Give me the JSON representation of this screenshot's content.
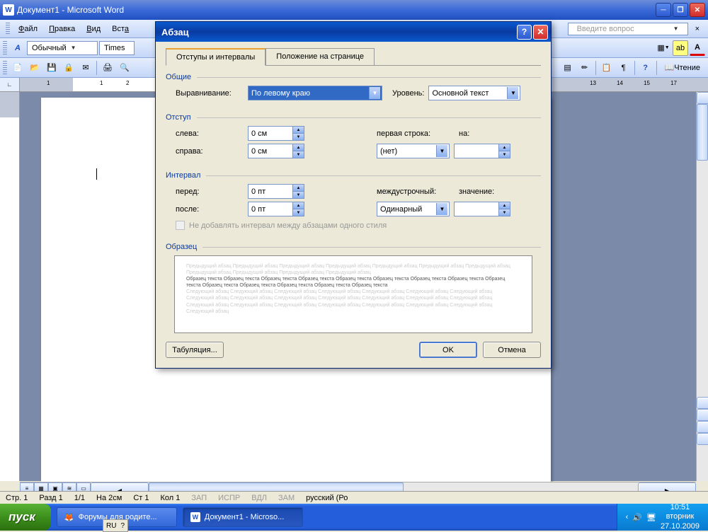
{
  "window": {
    "title": "Документ1 - Microsoft Word"
  },
  "menu": {
    "file": "Файл",
    "edit": "Правка",
    "view": "Вид",
    "insert": "Вста",
    "search_placeholder": "Введите вопрос"
  },
  "toolbar1": {
    "style": "Обычный",
    "font": "Times"
  },
  "toolbar2": {
    "reading": "Чтение"
  },
  "status": {
    "page": "Стр. 1",
    "section": "Разд 1",
    "pages": "1/1",
    "at": "На 2см",
    "line": "Ст 1",
    "col": "Кол 1",
    "rec": "ЗАП",
    "trk": "ИСПР",
    "ext": "ВДЛ",
    "ovr": "ЗАМ",
    "lang": "русский (Ро"
  },
  "taskbar": {
    "start": "пуск",
    "task1": "Форумы для родите...",
    "task2": "Документ1 - Microso...",
    "time": "10:51",
    "day": "вторник",
    "date": "27.10.2009",
    "lang": "RU"
  },
  "dialog": {
    "title": "Абзац",
    "tab1": "Отступы и интервалы",
    "tab2": "Положение на странице",
    "general": "Общие",
    "alignment_label": "Выравнивание:",
    "alignment_value": "По левому краю",
    "level_label": "Уровень:",
    "level_value": "Основной текст",
    "indent": "Отступ",
    "left_label": "слева:",
    "left_value": "0 см",
    "right_label": "справа:",
    "right_value": "0 см",
    "firstline_label": "первая строка:",
    "firstline_value": "(нет)",
    "by_label": "на:",
    "by_value": "",
    "spacing": "Интервал",
    "before_label": "перед:",
    "before_value": "0 пт",
    "after_label": "после:",
    "after_value": "0 пт",
    "linespacing_label": "междустрочный:",
    "linespacing_value": "Одинарный",
    "at_label": "значение:",
    "at_value": "",
    "noextra": "Не добавлять интервал между абзацами одного стиля",
    "preview": "Образец",
    "preview_grey": "Предыдущий абзац Предыдущий абзац Предыдущий абзац Предыдущий абзац Предыдущий абзац Предыдущий абзац Предыдущий абзац Предыдущий абзац Предыдущий абзац Предыдущий абзац Предыдущий абзац",
    "preview_text": "Образец текста Образец текста Образец текста Образец текста Образец текста Образец текста Образец текста Образец текста Образец текста Образец текста Образец текста Образец текста Образец текста Образец текста",
    "preview_grey2": "Следующий абзац Следующий абзац Следующий абзац Следующий абзац Следующий абзац Следующий абзац Следующий абзац Следующий абзац Следующий абзац Следующий абзац Следующий абзац Следующий абзац Следующий абзац Следующий абзац Следующий абзац Следующий абзац Следующий абзац Следующий абзац Следующий абзац Следующий абзац Следующий абзац Следующий абзац",
    "tabs_btn": "Табуляция...",
    "ok": "OK",
    "cancel": "Отмена"
  }
}
